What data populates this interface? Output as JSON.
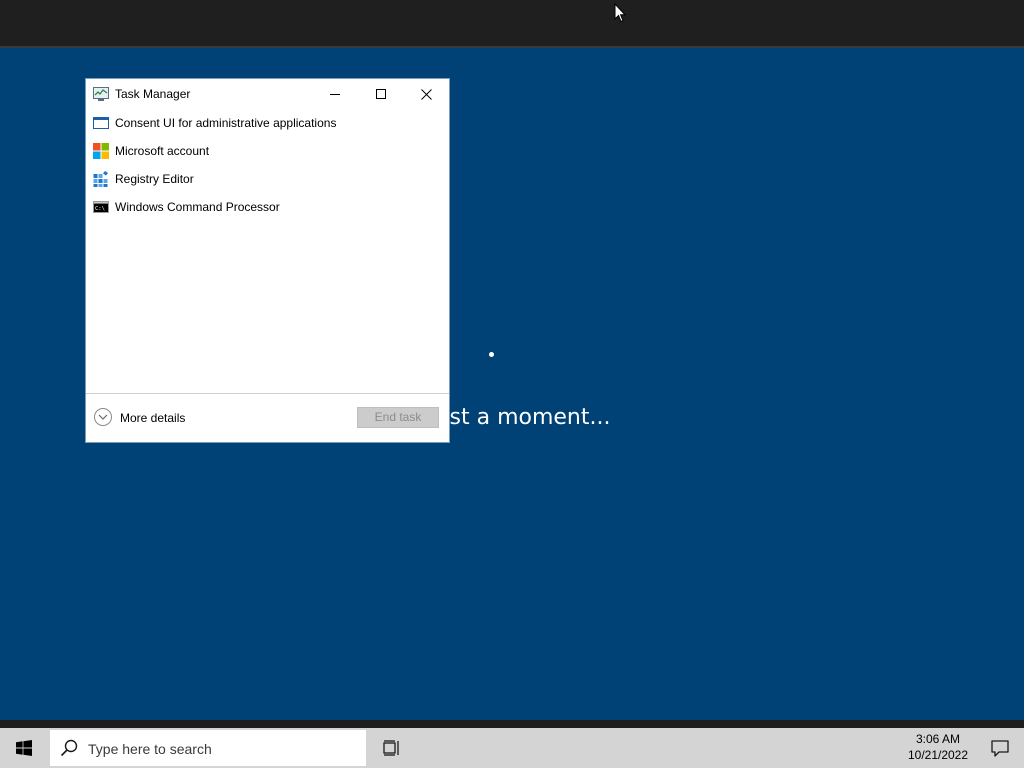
{
  "background": {
    "message": "st a moment...",
    "color": "#004275"
  },
  "task_manager": {
    "title": "Task Manager",
    "title_icon": "task-manager-icon",
    "controls": [
      "minimize-icon",
      "maximize-icon",
      "close-icon"
    ],
    "apps": [
      {
        "label": "Consent UI for administrative applications",
        "icon": "window-icon"
      },
      {
        "label": "Microsoft account",
        "icon": "microsoft-logo-icon"
      },
      {
        "label": "Registry Editor",
        "icon": "registry-editor-icon"
      },
      {
        "label": "Windows Command Processor",
        "icon": "command-prompt-icon"
      }
    ],
    "more_details_label": "More details",
    "end_task_label": "End task"
  },
  "taskbar": {
    "search_placeholder": "Type here to search",
    "time": "3:06 AM",
    "date": "10/21/2022",
    "icons": [
      "windows-start-icon",
      "search-icon",
      "task-view-icon",
      "action-center-icon"
    ]
  }
}
